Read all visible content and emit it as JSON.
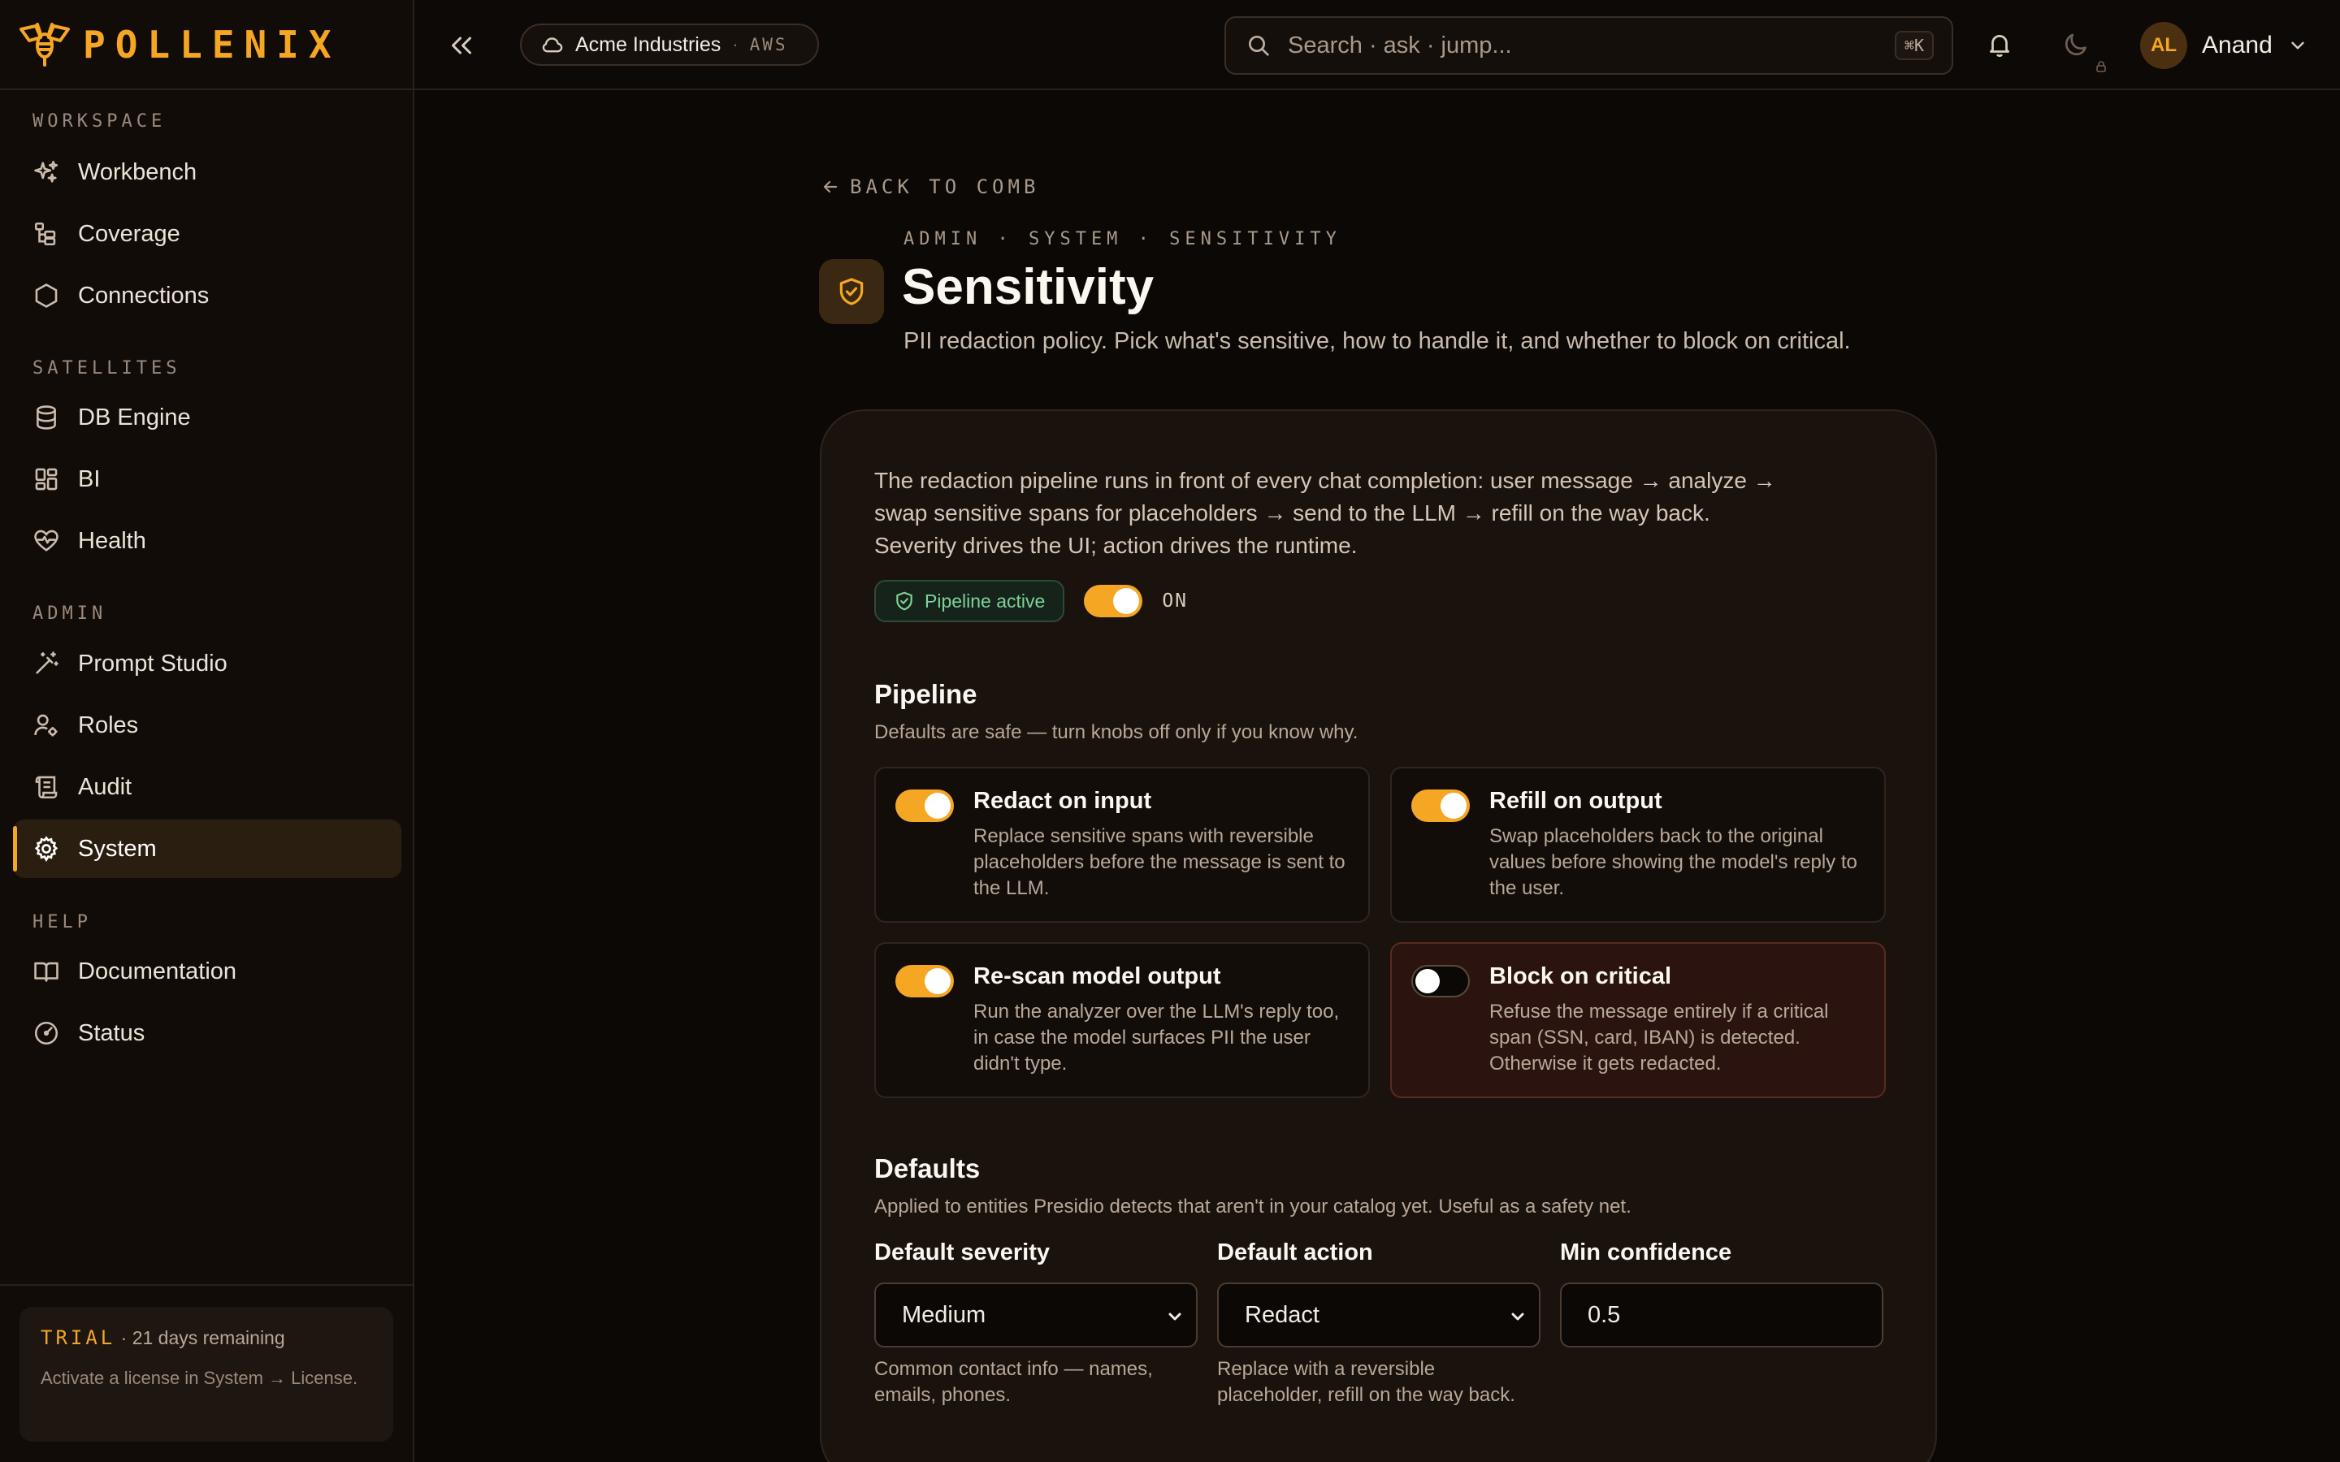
{
  "brand": {
    "name": "POLLENIX",
    "accent": "#f5a623"
  },
  "sidebar": {
    "sections": [
      {
        "heading": "WORKSPACE",
        "items": [
          {
            "label": "Workbench",
            "icon": "sparkles-icon"
          },
          {
            "label": "Coverage",
            "icon": "coverage-icon"
          },
          {
            "label": "Connections",
            "icon": "hexagon-icon"
          }
        ]
      },
      {
        "heading": "SATELLITES",
        "items": [
          {
            "label": "DB Engine",
            "icon": "database-icon"
          },
          {
            "label": "BI",
            "icon": "dashboard-icon"
          },
          {
            "label": "Health",
            "icon": "heart-pulse-icon"
          }
        ]
      },
      {
        "heading": "ADMIN",
        "items": [
          {
            "label": "Prompt Studio",
            "icon": "magic-wand-icon"
          },
          {
            "label": "Roles",
            "icon": "user-gear-icon"
          },
          {
            "label": "Audit",
            "icon": "audit-scroll-icon"
          },
          {
            "label": "System",
            "icon": "gear-icon",
            "active": true
          }
        ]
      },
      {
        "heading": "HELP",
        "items": [
          {
            "label": "Documentation",
            "icon": "book-icon"
          },
          {
            "label": "Status",
            "icon": "gauge-icon"
          }
        ]
      }
    ],
    "trial": {
      "tag": "TRIAL",
      "remaining": " · 21 days remaining",
      "message": "Activate a license in System → License."
    }
  },
  "topbar": {
    "tenant": {
      "name": "Acme Industries",
      "sep": "·",
      "cloud": "AWS"
    },
    "search": {
      "placeholder": "Search · ask · jump...",
      "shortcut": "⌘K"
    },
    "user": {
      "initials": "AL",
      "name": "Anand"
    }
  },
  "page": {
    "back_label": "BACK TO COMB",
    "breadcrumb": "ADMIN · SYSTEM · SENSITIVITY",
    "title": "Sensitivity",
    "subtitle": "PII redaction policy. Pick what's sensitive, how to handle it, and whether to block on critical.",
    "intro": [
      "The redaction pipeline runs in front of every chat completion: user message → analyze →",
      "swap sensitive spans for placeholders → send to the LLM → refill on the way back.",
      "Severity drives the UI; action drives the runtime."
    ],
    "status_pill": "Pipeline active",
    "pipeline_on": true,
    "pipeline_on_label": "ON",
    "pipeline": {
      "title": "Pipeline",
      "subtitle": "Defaults are safe — turn knobs off only if you know why.",
      "options": [
        {
          "title": "Redact on input",
          "on": true,
          "desc": "Replace sensitive spans with reversible placeholders before the message is sent to the LLM."
        },
        {
          "title": "Refill on output",
          "on": true,
          "desc": "Swap placeholders back to the original values before showing the model's reply to the user."
        },
        {
          "title": "Re-scan model output",
          "on": true,
          "desc": "Run the analyzer over the LLM's reply too, in case the model surfaces PII the user didn't type."
        },
        {
          "title": "Block on critical",
          "on": false,
          "desc": "Refuse the message entirely if a critical span (SSN, card, IBAN) is detected. Otherwise it gets redacted."
        }
      ]
    },
    "defaults": {
      "title": "Defaults",
      "subtitle": "Applied to entities Presidio detects that aren't in your catalog yet. Useful as a safety net.",
      "severity": {
        "label": "Default severity",
        "value": "Medium",
        "help": "Common contact info — names, emails, phones."
      },
      "action": {
        "label": "Default action",
        "value": "Redact",
        "help": "Replace with a reversible placeholder, refill on the way back."
      },
      "confidence": {
        "label": "Min confidence",
        "value": "0.5"
      }
    }
  },
  "colors": {
    "background": "#0b0806",
    "card": "#1a120d",
    "success": "#7fd29a",
    "danger_bg": "#2b140f"
  }
}
